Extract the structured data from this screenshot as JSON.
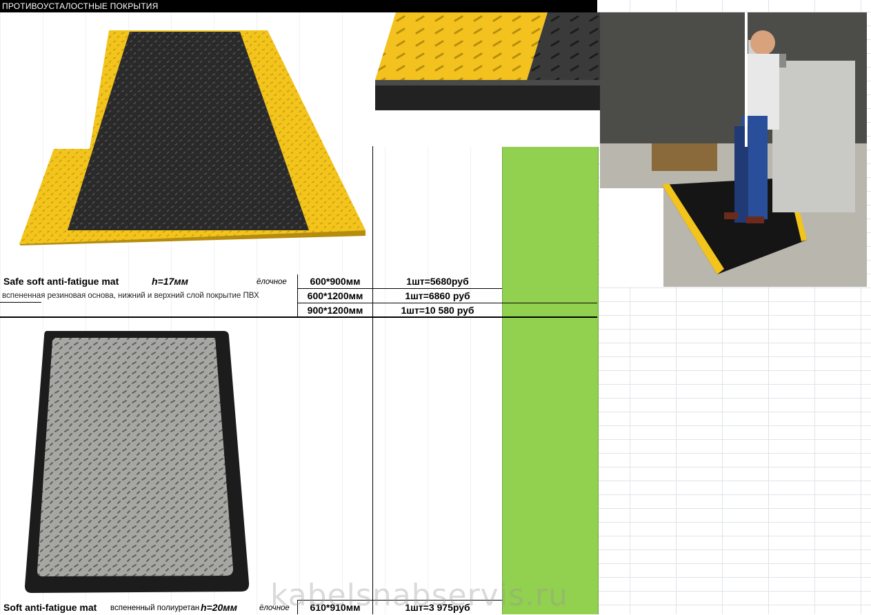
{
  "sheet": {
    "title": "ПРОТИВОУСТАЛОСТНЫЕ ПОКРЫТИЯ"
  },
  "products": [
    {
      "name": "Safe soft anti-fatigue mat",
      "height": "h=17мм",
      "pattern": "ёлочное",
      "description": "вспененная резиновая основа, нижний и верхний слой покрытие ПВХ",
      "sizes": [
        {
          "size": "600*900мм",
          "price": "1шт=5680руб"
        },
        {
          "size": "600*1200мм",
          "price": "1шт=6860 руб"
        },
        {
          "size": "900*1200мм",
          "price": "1шт=10 580 руб"
        }
      ]
    },
    {
      "name": "Soft anti-fatigue mat",
      "description": "вспененный полиуретан",
      "height": "h=20мм",
      "pattern": "ёлочное",
      "sizes": [
        {
          "size": "610*910мм",
          "price": "1шт=3 975руб"
        }
      ]
    }
  ],
  "watermark": "kabelsnabservis.ru",
  "colors": {
    "header_bg": "#000000",
    "price_column": "#92d050",
    "mat_yellow": "#f2c41c",
    "mat_black": "#2a2a2a",
    "mat_grey": "#9a9a9a"
  },
  "images": [
    {
      "icon": "yellow-black-mat-image"
    },
    {
      "icon": "mat-edge-closeup-image"
    },
    {
      "icon": "worker-on-mat-photo"
    },
    {
      "icon": "grey-black-mat-image"
    }
  ]
}
